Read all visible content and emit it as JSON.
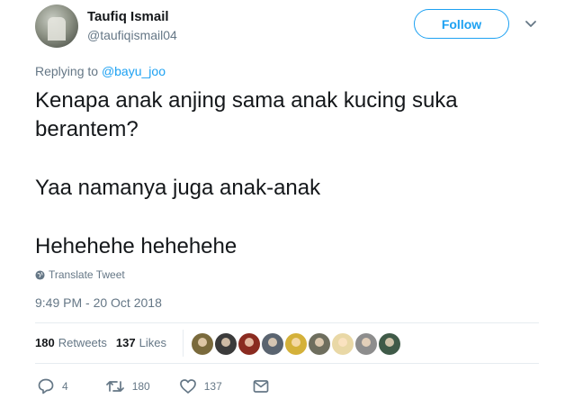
{
  "author": {
    "name": "Taufiq Ismail",
    "handle": "@taufiqismail04"
  },
  "follow_label": "Follow",
  "replying_prefix": "Replying to",
  "replying_to": "@bayu_joo",
  "tweet_lines": [
    "Kenapa anak anjing sama anak kucing suka berantem?",
    "Yaa namanya juga anak-anak",
    "Hehehehe hehehehe"
  ],
  "translate_label": "Translate Tweet",
  "timestamp": "9:49 PM - 20 Oct 2018",
  "stats": {
    "retweets_count": "180",
    "retweets_label": "Retweets",
    "likes_count": "137",
    "likes_label": "Likes"
  },
  "likers": [
    {
      "color": "#7a6a3c"
    },
    {
      "color": "#3b3b3b"
    },
    {
      "color": "#8a2b20"
    },
    {
      "color": "#5a6470"
    },
    {
      "color": "#d4b13a"
    },
    {
      "color": "#6e6e5e"
    },
    {
      "color": "#e9d8a6"
    },
    {
      "color": "#8d8d8d"
    },
    {
      "color": "#3f5a48"
    }
  ],
  "actions": {
    "replies": "4",
    "retweets": "180",
    "likes": "137"
  },
  "colors": {
    "accent": "#1da1f2",
    "muted": "#657786",
    "text": "#14171a"
  }
}
